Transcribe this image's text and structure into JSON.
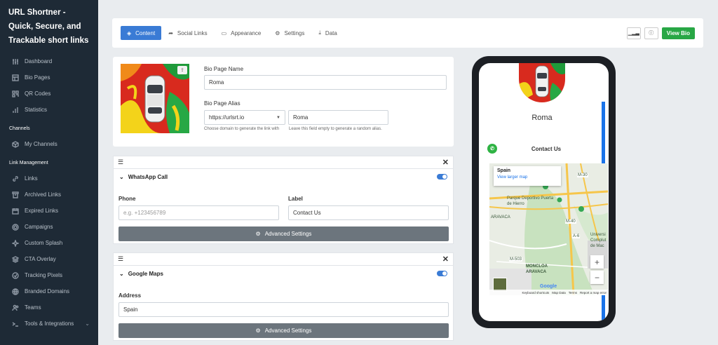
{
  "sidebar": {
    "brand": "URL Shortner - Quick, Secure, and Trackable short links",
    "items_main": [
      {
        "label": "Dashboard",
        "icon": "sliders-icon"
      },
      {
        "label": "Bio Pages",
        "icon": "layout-icon"
      },
      {
        "label": "QR Codes",
        "icon": "qr-icon"
      },
      {
        "label": "Statistics",
        "icon": "bar-chart-icon"
      }
    ],
    "channels_heading": "Channels",
    "items_channels": [
      {
        "label": "My Channels",
        "icon": "box-icon"
      }
    ],
    "link_heading": "Link Management",
    "items_links": [
      {
        "label": "Links",
        "icon": "link-icon"
      },
      {
        "label": "Archived Links",
        "icon": "archive-icon"
      },
      {
        "label": "Expired Links",
        "icon": "calendar-icon"
      },
      {
        "label": "Campaigns",
        "icon": "target-icon"
      },
      {
        "label": "Custom Splash",
        "icon": "splash-icon"
      },
      {
        "label": "CTA Overlay",
        "icon": "layers-icon"
      },
      {
        "label": "Tracking Pixels",
        "icon": "pixel-icon"
      },
      {
        "label": "Branded Domains",
        "icon": "globe-icon"
      },
      {
        "label": "Teams",
        "icon": "users-icon"
      },
      {
        "label": "Tools & Integrations",
        "icon": "terminal-icon"
      }
    ]
  },
  "toolbar": {
    "tabs": [
      {
        "label": "Content",
        "icon": "layers-icon"
      },
      {
        "label": "Social Links",
        "icon": "share-icon"
      },
      {
        "label": "Appearance",
        "icon": "monitor-icon"
      },
      {
        "label": "Settings",
        "icon": "gears-icon"
      },
      {
        "label": "Data",
        "icon": "download-icon"
      }
    ],
    "view_bio": "View Bio"
  },
  "profile": {
    "name_label": "Bio Page Name",
    "name_value": "Roma",
    "alias_label": "Bio Page Alias",
    "domain_value": "https://urlsrt.io",
    "alias_value": "Roma",
    "domain_hint": "Choose domain to generate the link with",
    "alias_hint": "Leave this field empty to generate a random alias."
  },
  "blocks": {
    "whatsapp": {
      "title": "WhatsApp Call",
      "phone_label": "Phone",
      "phone_placeholder": "e.g. +123456789",
      "label_label": "Label",
      "label_value": "Contact Us",
      "advanced": "Advanced Settings",
      "enabled": true
    },
    "maps": {
      "title": "Google Maps",
      "address_label": "Address",
      "address_value": "Spain",
      "advanced": "Advanced Settings",
      "enabled": true
    }
  },
  "preview": {
    "name": "Roma",
    "contact": "Contact Us",
    "map_popup_title": "Spain",
    "map_popup_link": "View larger map",
    "map_labels": [
      "Parque Deportivo Puerta de Hierro",
      "ARAVACA",
      "MONCLOA ARAVACA",
      "Universi Complut de Mac",
      "M-30",
      "M-40",
      "M-503",
      "A-6"
    ],
    "map_footer": [
      "Keyboard shortcuts",
      "Map Data",
      "Terms",
      "Report a map error"
    ],
    "google": "Google",
    "zoom_in": "+",
    "zoom_out": "−"
  },
  "colors": {
    "sidebar_bg": "#1e2a36",
    "accent": "#3a7bd5",
    "success": "#28a745",
    "secondary": "#6c757d"
  }
}
